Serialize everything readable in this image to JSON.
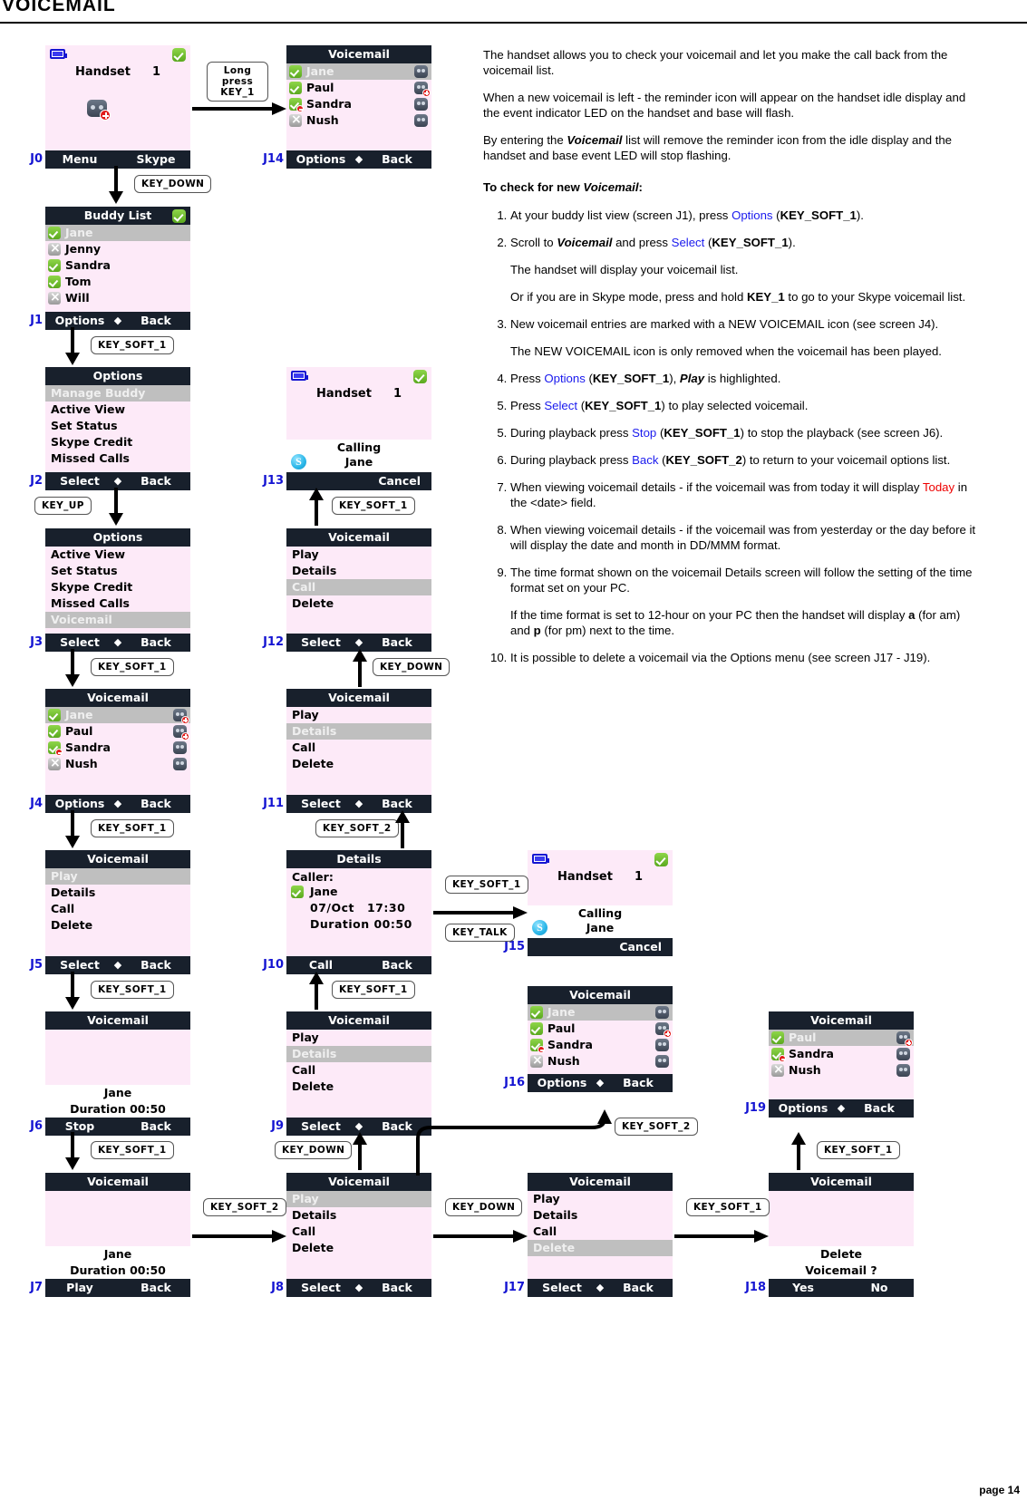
{
  "page": {
    "title": "VOICEMAIL",
    "footer": "page 14"
  },
  "doc": {
    "p1": "The handset allows you to check your voicemail and let you make the call back from the voicemail list.",
    "p2": "When a new voicemail is left - the reminder icon will appear on the handset idle display and the event indicator LED on the handset and base will flash.",
    "p3_a": "By entering the ",
    "p3_em": "Voicemail",
    "p3_b": " list will remove the reminder icon from the idle display and the handset and base event LED will stop flashing.",
    "heading_a": "To check for new ",
    "heading_em": "Voicemail",
    "heading_b": ":",
    "steps": [
      {
        "id": "step-1",
        "parts": [
          "At your buddy list view (screen J1), press ",
          "Options",
          " (",
          "KEY_SOFT_1",
          ")."
        ]
      },
      {
        "id": "step-2",
        "parts": [
          "Scroll to ",
          "Voicemail",
          " and press ",
          "Select",
          " (",
          "KEY_SOFT_1",
          ")."
        ],
        "sub1": "The handset will display your voicemail list.",
        "sub2_a": "Or if you are in Skype mode, press and hold ",
        "sub2_k": "KEY_1",
        "sub2_b": " to go to your Skype voicemail list."
      },
      {
        "id": "step-3",
        "text": "New voicemail entries are marked with a NEW VOICEMAIL icon (see screen J4).",
        "sub1": "The NEW VOICEMAIL icon is only removed when the voicemail has been played."
      },
      {
        "id": "step-4",
        "parts": [
          "Press ",
          "Options",
          " (",
          "KEY_SOFT_1",
          "), ",
          "Play",
          " is highlighted."
        ]
      },
      {
        "id": "step-5",
        "parts": [
          "Press ",
          "Select",
          " (",
          "KEY_SOFT_1",
          ") to play selected voicemail."
        ]
      },
      {
        "id": "step-5b",
        "parts": [
          "During playback press ",
          "Stop",
          " (",
          "KEY_SOFT_1",
          ") to stop the playback (see screen J6)."
        ]
      },
      {
        "id": "step-6",
        "parts": [
          "During playback press ",
          "Back",
          " (",
          "KEY_SOFT_2",
          ") to return to your voicemail options list."
        ]
      },
      {
        "id": "step-7",
        "a": "When viewing voicemail details - if the voicemail was from today it will display ",
        "red": "Today",
        "b": " in the <date> field."
      },
      {
        "id": "step-8",
        "text": "When viewing voicemail details - if the voicemail was from yesterday or the day before it will display the date and month in DD/MMM format."
      },
      {
        "id": "step-9",
        "text": "The time format shown on the voicemail Details screen will follow the setting of the time format set on your PC.",
        "sub_a": "If the time format is set to 12-hour on your PC then the handset will display ",
        "sub_k1": "a",
        "sub_mid": " (for am) and ",
        "sub_k2": "p",
        "sub_b": " (for pm) next to the time."
      },
      {
        "id": "step-10",
        "text": "It is possible to delete a voicemail via the Options menu (see screen J17 - J19)."
      }
    ]
  },
  "screens": {
    "J0": {
      "id": "J0",
      "handset": "Handset",
      "handset_num": "1",
      "soft_left": "Menu",
      "soft_right": "Skype"
    },
    "J1": {
      "id": "J1",
      "title": "Buddy List",
      "items": [
        {
          "label": "Jane",
          "presence": "online",
          "highlight": true
        },
        {
          "label": "Jenny",
          "presence": "offline",
          "highlight": false
        },
        {
          "label": "Sandra",
          "presence": "online",
          "highlight": false
        },
        {
          "label": "Tom",
          "presence": "online",
          "highlight": false
        },
        {
          "label": "Will",
          "presence": "offline",
          "highlight": false
        }
      ],
      "soft_left": "Options",
      "soft_right": "Back"
    },
    "J2": {
      "id": "J2",
      "title": "Options",
      "items": [
        {
          "label": "Manage Buddy",
          "highlight": true
        },
        {
          "label": "Active View",
          "highlight": false
        },
        {
          "label": "Set Status",
          "highlight": false
        },
        {
          "label": "Skype Credit",
          "highlight": false
        },
        {
          "label": "Missed Calls",
          "highlight": false
        }
      ],
      "soft_left": "Select",
      "soft_right": "Back"
    },
    "J3": {
      "id": "J3",
      "title": "Options",
      "items": [
        {
          "label": "Active View",
          "highlight": false
        },
        {
          "label": "Set Status",
          "highlight": false
        },
        {
          "label": "Skype Credit",
          "highlight": false
        },
        {
          "label": "Missed Calls",
          "highlight": false
        },
        {
          "label": "Voicemail",
          "highlight": true
        }
      ],
      "soft_left": "Select",
      "soft_right": "Back"
    },
    "J4": {
      "id": "J4",
      "title": "Voicemail",
      "items": [
        {
          "label": "Jane",
          "presence": "online",
          "vm": "new",
          "highlight": true
        },
        {
          "label": "Paul",
          "presence": "online",
          "vm": "new",
          "highlight": false
        },
        {
          "label": "Sandra",
          "presence": "dnd",
          "vm": "read",
          "highlight": false
        },
        {
          "label": "Nush",
          "presence": "offline",
          "vm": "read",
          "highlight": false
        }
      ],
      "soft_left": "Options",
      "soft_right": "Back"
    },
    "J5": {
      "id": "J5",
      "title": "Voicemail",
      "items": [
        {
          "label": "Play",
          "highlight": true
        },
        {
          "label": "Details",
          "highlight": false
        },
        {
          "label": "Call",
          "highlight": false
        },
        {
          "label": "Delete",
          "highlight": false
        }
      ],
      "soft_left": "Select",
      "soft_right": "Back"
    },
    "J6": {
      "id": "J6",
      "title": "Voicemail",
      "caller": "Jane",
      "duration": "Duration 00:50",
      "soft_left": "Stop",
      "soft_right": "Back"
    },
    "J7": {
      "id": "J7",
      "title": "Voicemail",
      "caller": "Jane",
      "duration": "Duration 00:50",
      "soft_left": "Play",
      "soft_right": "Back"
    },
    "J8": {
      "id": "J8",
      "title": "Voicemail",
      "items": [
        {
          "label": "Play",
          "highlight": true
        },
        {
          "label": "Details",
          "highlight": false
        },
        {
          "label": "Call",
          "highlight": false
        },
        {
          "label": "Delete",
          "highlight": false
        }
      ],
      "soft_left": "Select",
      "soft_right": "Back"
    },
    "J9": {
      "id": "J9",
      "title": "Voicemail",
      "items": [
        {
          "label": "Play",
          "highlight": false
        },
        {
          "label": "Details",
          "highlight": true
        },
        {
          "label": "Call",
          "highlight": false
        },
        {
          "label": "Delete",
          "highlight": false
        }
      ],
      "soft_left": "Select",
      "soft_right": "Back"
    },
    "J10": {
      "id": "J10",
      "title": "Details",
      "caller_label": "Caller:",
      "caller_name": "Jane",
      "date": "07/Oct",
      "time": "17:30",
      "duration_label": "Duration",
      "duration_value": "00:50",
      "soft_left": "Call",
      "soft_right": "Back"
    },
    "J11": {
      "id": "J11",
      "title": "Voicemail",
      "items": [
        {
          "label": "Play",
          "highlight": false
        },
        {
          "label": "Details",
          "highlight": true
        },
        {
          "label": "Call",
          "highlight": false
        },
        {
          "label": "Delete",
          "highlight": false
        }
      ],
      "soft_left": "Select",
      "soft_right": "Back"
    },
    "J12": {
      "id": "J12",
      "title": "Voicemail",
      "items": [
        {
          "label": "Play",
          "highlight": false
        },
        {
          "label": "Details",
          "highlight": false
        },
        {
          "label": "Call",
          "highlight": true
        },
        {
          "label": "Delete",
          "highlight": false
        }
      ],
      "soft_left": "Select",
      "soft_right": "Back"
    },
    "J13": {
      "id": "J13",
      "handset": "Handset",
      "handset_num": "1",
      "calling": "Calling",
      "calling_name": "Jane",
      "soft_right": "Cancel"
    },
    "J14": {
      "id": "J14",
      "title": "Voicemail",
      "items": [
        {
          "label": "Jane",
          "presence": "online",
          "vm": "read",
          "highlight": true
        },
        {
          "label": "Paul",
          "presence": "online",
          "vm": "new",
          "highlight": false
        },
        {
          "label": "Sandra",
          "presence": "dnd",
          "vm": "read",
          "highlight": false
        },
        {
          "label": "Nush",
          "presence": "offline",
          "vm": "read",
          "highlight": false
        }
      ],
      "soft_left": "Options",
      "soft_right": "Back"
    },
    "J15": {
      "id": "J15",
      "handset": "Handset",
      "handset_num": "1",
      "calling": "Calling",
      "calling_name": "Jane",
      "soft_right": "Cancel"
    },
    "J16": {
      "id": "J16",
      "title": "Voicemail",
      "items": [
        {
          "label": "Jane",
          "presence": "online",
          "vm": "read",
          "highlight": true
        },
        {
          "label": "Paul",
          "presence": "online",
          "vm": "new",
          "highlight": false
        },
        {
          "label": "Sandra",
          "presence": "dnd",
          "vm": "read",
          "highlight": false
        },
        {
          "label": "Nush",
          "presence": "offline",
          "vm": "read",
          "highlight": false
        }
      ],
      "soft_left": "Options",
      "soft_right": "Back"
    },
    "J17": {
      "id": "J17",
      "title": "Voicemail",
      "items": [
        {
          "label": "Play",
          "highlight": false
        },
        {
          "label": "Details",
          "highlight": false
        },
        {
          "label": "Call",
          "highlight": false
        },
        {
          "label": "Delete",
          "highlight": true
        }
      ],
      "soft_left": "Select",
      "soft_right": "Back"
    },
    "J18": {
      "id": "J18",
      "title": "Voicemail",
      "confirm_l1": "Delete",
      "confirm_l2": "Voicemail ?",
      "soft_left": "Yes",
      "soft_right": "No"
    },
    "J19": {
      "id": "J19",
      "title": "Voicemail",
      "items": [
        {
          "label": "Paul",
          "presence": "online",
          "vm": "new",
          "highlight": true
        },
        {
          "label": "Sandra",
          "presence": "dnd",
          "vm": "read",
          "highlight": false
        },
        {
          "label": "Nush",
          "presence": "offline",
          "vm": "read",
          "highlight": false
        }
      ],
      "soft_left": "Options",
      "soft_right": "Back"
    }
  },
  "keys": {
    "long_press_key1": "Long press\nKEY_1",
    "key_down": "KEY_DOWN",
    "key_up": "KEY_UP",
    "key_soft_1": "KEY_SOFT_1",
    "key_soft_2": "KEY_SOFT_2",
    "key_talk": "KEY_TALK"
  }
}
